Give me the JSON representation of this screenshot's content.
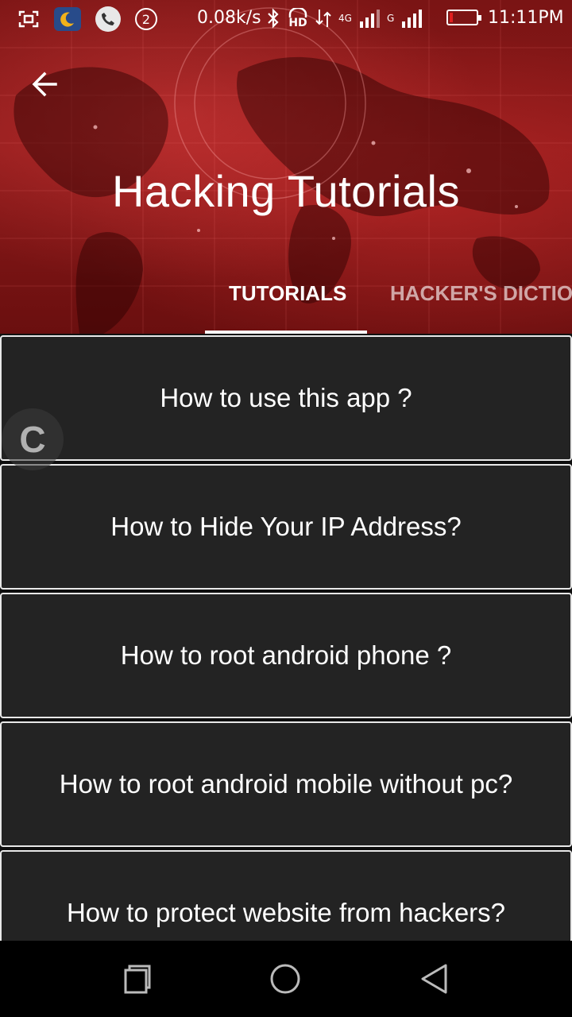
{
  "status_bar": {
    "speed": "0.08k/s",
    "notification_badge": "2",
    "hd_label": "HD",
    "net_4g": "4G",
    "net_g": "G",
    "time": "11:11PM",
    "icons": [
      "screenshot-icon",
      "night-mode-icon",
      "call-icon",
      "badge-icon",
      "bluetooth-icon",
      "headset-hd-icon",
      "data-transfer-icon",
      "signal-icon",
      "battery-icon"
    ]
  },
  "app_bar": {
    "back_icon": "arrow-left-icon",
    "title": "Hacking Tutorials"
  },
  "tabs": [
    {
      "label": "TUTORIALS",
      "active": true
    },
    {
      "label": "HACKER'S DICTIO",
      "active": false
    }
  ],
  "tutorials": [
    {
      "title": "How to use this app ?"
    },
    {
      "title": "How to Hide Your IP Address?"
    },
    {
      "title": "How to root android phone ?"
    },
    {
      "title": "How to root android mobile without pc?"
    },
    {
      "title": "How to protect website from hackers?"
    }
  ],
  "floating_button": {
    "letter": "C"
  },
  "nav_bar": {
    "icons": [
      "recent-apps-icon",
      "home-icon",
      "back-triangle-icon"
    ]
  },
  "colors": {
    "header_red": "#8e1a1a",
    "card_bg": "#232323",
    "card_border": "#e8e8e8",
    "nav_bg": "#000000"
  }
}
